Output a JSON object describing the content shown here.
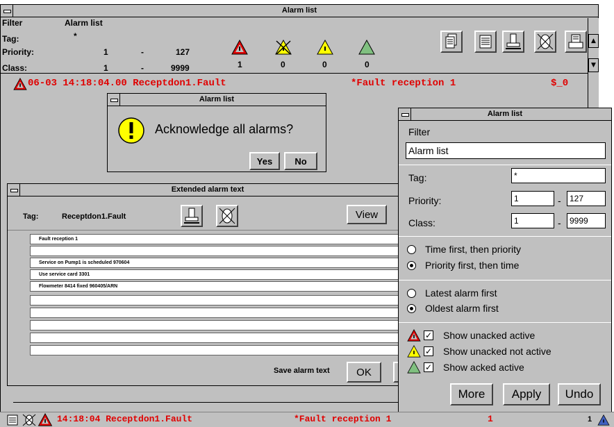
{
  "main_window": {
    "title": "Alarm list",
    "filter_label": "Filter",
    "filter_value": "Alarm list",
    "tag_label": "Tag:",
    "tag_value": "*",
    "priority_label": "Priority:",
    "priority_from": "1",
    "priority_dash": "-",
    "priority_to": "127",
    "class_label": "Class:",
    "class_from": "1",
    "class_dash": "-",
    "class_to": "9999",
    "counts": [
      "1",
      "0",
      "0",
      "0"
    ],
    "alarm_row": {
      "timestamp": "06-03 14:18:04.00 Receptdon1.Fault",
      "text": "*Fault reception 1",
      "value": "$_0"
    }
  },
  "ack_dialog": {
    "title": "Alarm list",
    "message": "Acknowledge all alarms?",
    "yes": "Yes",
    "no": "No",
    "icon": "exclamation-icon"
  },
  "ext_window": {
    "title": "Extended alarm text",
    "tag_label": "Tag:",
    "tag_value": "Receptdon1.Fault",
    "view_button": "View",
    "rows": [
      "Fault reception 1",
      "",
      "Service on Pump1 is scheduled 970604",
      "Use service card 3301",
      "Flowmeter 8414 fixed 960405/ARN",
      "",
      "",
      "",
      "",
      ""
    ],
    "save_label": "Save alarm text",
    "ok_button": "OK"
  },
  "filter_dialog": {
    "title": "Alarm list",
    "filter_label": "Filter",
    "filter_value": "Alarm list",
    "tag_label": "Tag:",
    "tag_value": "*",
    "priority_label": "Priority:",
    "priority_from": "1",
    "priority_dash": "-",
    "priority_to": "127",
    "class_label": "Class:",
    "class_from": "1",
    "class_dash": "-",
    "class_to": "9999",
    "sort_options": [
      "Time first, then priority",
      "Priority first, then time"
    ],
    "order_options": [
      "Latest alarm first",
      "Oldest alarm first"
    ],
    "show_options": [
      "Show unacked active",
      "Show unacked not active",
      "Show acked active"
    ],
    "more": "More",
    "apply": "Apply",
    "undo": "Undo"
  },
  "status_bar": {
    "time": "14:18:04 Receptdon1.Fault",
    "text": "*Fault reception 1",
    "count": "1",
    "right_count": "1"
  },
  "colors": {
    "background": "#c0c0c0",
    "alarm_red": "#e00000",
    "yellow": "#ffff00",
    "green": "#80c080"
  }
}
